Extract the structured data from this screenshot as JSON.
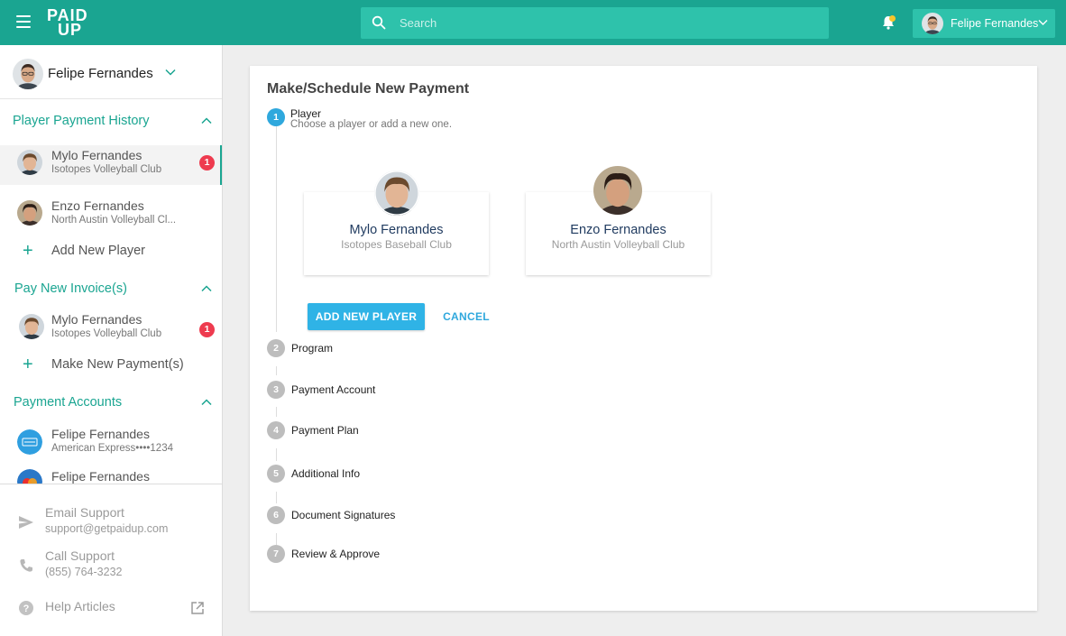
{
  "app": {
    "logo_line1": "PAID",
    "logo_line2": "UP"
  },
  "topbar": {
    "search_placeholder": "Search",
    "user_name": "Felipe Fernandes",
    "notification_dot_color": "#f7c52b"
  },
  "sidebar": {
    "profile_name": "Felipe Fernandes",
    "sections": [
      {
        "title": "Player Payment History",
        "items": [
          {
            "name": "Mylo Fernandes",
            "sub": "Isotopes Volleyball Club",
            "badge": "1"
          },
          {
            "name": "Enzo Fernandes",
            "sub": "North Austin Volleyball Cl..."
          }
        ],
        "add_label": "Add New Player"
      },
      {
        "title": "Pay New Invoice(s)",
        "items": [
          {
            "name": "Mylo Fernandes",
            "sub": "Isotopes Volleyball Club",
            "badge": "1"
          }
        ],
        "add_label": "Make New Payment(s)"
      },
      {
        "title": "Payment Accounts",
        "items": [
          {
            "name": "Felipe Fernandes",
            "sub": "American Express••••1234"
          },
          {
            "name": "Felipe Fernandes"
          }
        ]
      }
    ],
    "support": {
      "email_title": "Email Support",
      "email": "support@getpaidup.com",
      "call_title": "Call Support",
      "phone": "(855) 764-3232",
      "help": "Help Articles"
    }
  },
  "main": {
    "title": "Make/Schedule New Payment",
    "steps": [
      {
        "num": "1",
        "label": "Player",
        "sub": "Choose a player or add a new one."
      },
      {
        "num": "2",
        "label": "Program"
      },
      {
        "num": "3",
        "label": "Payment Account"
      },
      {
        "num": "4",
        "label": "Payment Plan"
      },
      {
        "num": "5",
        "label": "Additional Info"
      },
      {
        "num": "6",
        "label": "Document Signatures"
      },
      {
        "num": "7",
        "label": "Review & Approve"
      }
    ],
    "players": [
      {
        "name": "Mylo Fernandes",
        "club": "Isotopes Baseball Club"
      },
      {
        "name": "Enzo Fernandes",
        "club": "North Austin Volleyball Club"
      }
    ],
    "add_button": "ADD NEW PLAYER",
    "cancel_button": "CANCEL"
  },
  "colors": {
    "brand_teal": "#1aa591",
    "accent_blue": "#2fb3e6",
    "badge_red": "#ee3b4f"
  }
}
